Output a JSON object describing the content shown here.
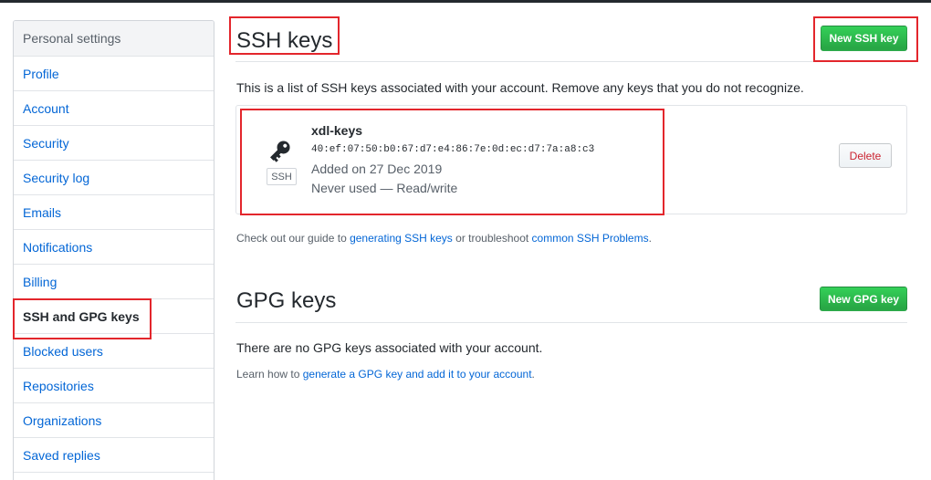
{
  "sidebar": {
    "header": "Personal settings",
    "items": [
      {
        "label": "Profile"
      },
      {
        "label": "Account"
      },
      {
        "label": "Security"
      },
      {
        "label": "Security log"
      },
      {
        "label": "Emails"
      },
      {
        "label": "Notifications"
      },
      {
        "label": "Billing"
      },
      {
        "label": "SSH and GPG keys",
        "selected": true
      },
      {
        "label": "Blocked users"
      },
      {
        "label": "Repositories"
      },
      {
        "label": "Organizations"
      },
      {
        "label": "Saved replies"
      }
    ]
  },
  "ssh": {
    "title": "SSH keys",
    "new_button": "New SSH key",
    "description": "This is a list of SSH keys associated with your account. Remove any keys that you do not recognize.",
    "key": {
      "name": "xdl-keys",
      "fingerprint": "40:ef:07:50:b0:67:d7:e4:86:7e:0d:ec:d7:7a:a8:c3",
      "added": "Added on 27 Dec 2019",
      "usage": "Never used — Read/write",
      "type_label": "SSH",
      "delete_button": "Delete"
    },
    "guide": {
      "prefix": "Check out our guide to ",
      "link1": "generating SSH keys",
      "middle": " or troubleshoot ",
      "link2": "common SSH Problems",
      "suffix": "."
    }
  },
  "gpg": {
    "title": "GPG keys",
    "new_button": "New GPG key",
    "empty_text": "There are no GPG keys associated with your account.",
    "learn": {
      "prefix": "Learn how to ",
      "link": "generate a GPG key and add it to your account",
      "suffix": "."
    }
  },
  "colors": {
    "link": "#0366d6",
    "green": "#28a745",
    "danger": "#cb2431",
    "annotation": "#e3262c"
  }
}
